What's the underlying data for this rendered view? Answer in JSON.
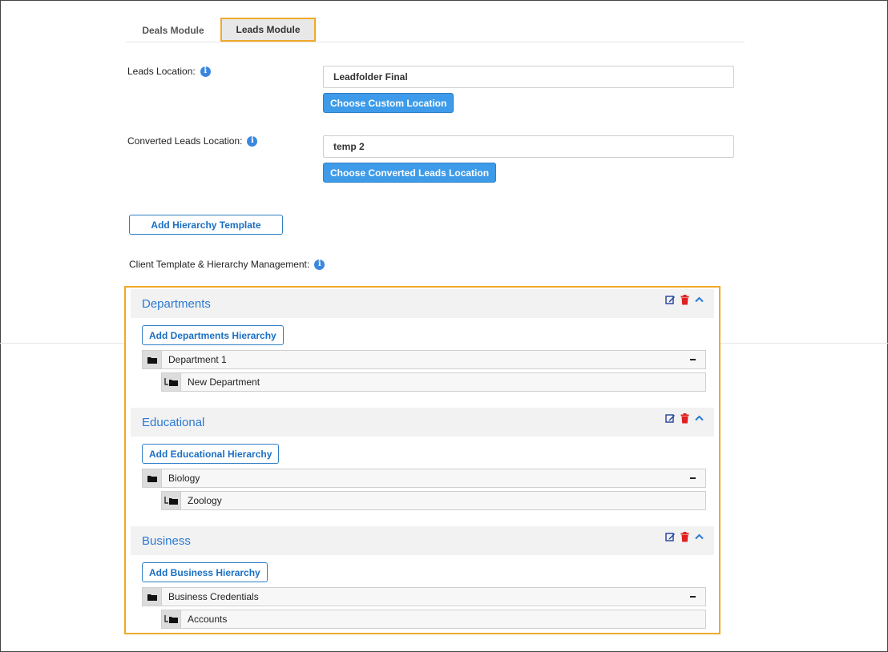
{
  "tabs": [
    {
      "label": "Deals Module",
      "active": false
    },
    {
      "label": "Leads Module",
      "active": true
    }
  ],
  "leads_location": {
    "label": "Leads Location:",
    "value": "Leadfolder Final",
    "button": "Choose Custom Location"
  },
  "converted_location": {
    "label": "Converted Leads Location:",
    "value": "temp 2",
    "button": "Choose Converted Leads Location"
  },
  "add_template_button": "Add Hierarchy Template",
  "client_template_label": "Client Template & Hierarchy Management:",
  "hierarchies": [
    {
      "title": "Departments",
      "add_button": "Add Departments Hierarchy",
      "parent": "Department 1",
      "child": "New Department"
    },
    {
      "title": "Educational",
      "add_button": "Add Educational Hierarchy",
      "parent": "Biology",
      "child": "Zoology"
    },
    {
      "title": "Business",
      "add_button": "Add Business Hierarchy",
      "parent": "Business Credentials",
      "child": "Accounts"
    }
  ],
  "colors": {
    "accent": "#3d9be9",
    "highlight": "#f0a929",
    "section_title": "#2a7ad5",
    "delete": "#e02020"
  },
  "icons": {
    "info": "info-icon",
    "edit": "edit-icon",
    "delete": "trash-icon",
    "collapse": "chevron-up-icon",
    "folder": "folder-icon"
  }
}
